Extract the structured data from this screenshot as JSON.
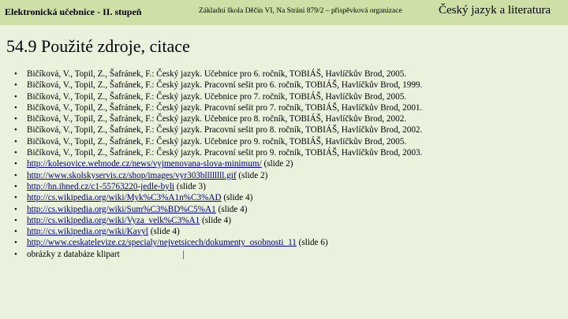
{
  "header": {
    "left": "Elektronická učebnice - II. stupeň",
    "middle": "Základní škola Děčín VI, Na Stráni 879/2 – příspěvková organizace",
    "right": "Český jazyk a literatura"
  },
  "slide": {
    "title": "54.9 Použité zdroje, citace"
  },
  "references": [
    {
      "text": "Bičíková, V., Topil, Z., Šafránek, F.: Český jazyk. Učebnice pro 6. ročník, TOBIÁŠ, Havlíčkův Brod, 2005."
    },
    {
      "text": "Bičíková, V., Topil, Z., Šafránek, F.: Český jazyk. Pracovní sešit pro 6. ročník, TOBIÁŠ, Havlíčkův Brod, 1999."
    },
    {
      "text": "Bičíková, V., Topil, Z., Šafránek, F.: Český jazyk. Učebnice pro 7. ročník, TOBIÁŠ, Havlíčkův Brod, 2005."
    },
    {
      "text": "Bičíková, V., Topil, Z., Šafránek, F.: Český jazyk. Pracovní sešit pro 7. ročník, TOBIÁŠ, Havlíčkův Brod, 2001."
    },
    {
      "text": "Bičíková, V., Topil, Z., Šafránek, F.: Český jazyk. Učebnice pro 8. ročník, TOBIÁŠ, Havlíčkův Brod, 2002."
    },
    {
      "text": "Bičíková, V., Topil, Z., Šafránek, F.: Český jazyk. Pracovní sešit pro 8. ročník, TOBIÁŠ, Havlíčkův Brod, 2002."
    },
    {
      "text": "Bičíková, V., Topil, Z., Šafránek, F.: Český jazyk. Učebnice pro 9. ročník, TOBIÁŠ, Havlíčkův Brod, 2005."
    },
    {
      "text": "Bičíková, V., Topil, Z., Šafránek, F.: Český jazyk. Pracovní sešit pro 9. ročník, TOBIÁŠ, Havlíčkův Brod, 2003."
    },
    {
      "link": "http://kolesovice.webnode.cz/news/vyjmenovana-slova-minimum/",
      "suffix": " (slide 2)"
    },
    {
      "link": "http://www.skolskyservis.cz/shop/images/vyr303bllllllll.gif",
      "suffix": " (slide 2)"
    },
    {
      "link": "http://hn.ihned.cz/c1-55763220-jedle-byli",
      "suffix": " (slide 3)"
    },
    {
      "link": "http://cs.wikipedia.org/wiki/Myk%C3%A1n%C3%AD",
      "suffix": " (slide 4)"
    },
    {
      "link": "http://cs.wikipedia.org/wiki/Sum%C3%BD%C5%A1",
      "suffix": " (slide 4)"
    },
    {
      "link": "http://cs.wikipedia.org/wiki/Vyza_velk%C3%A1",
      "suffix": " (slide 4)"
    },
    {
      "link": "http://cs.wikipedia.org/wiki/Kavyl",
      "suffix": " (slide 4)"
    },
    {
      "link": "http://www.ceskatelevize.cz/specialy/nejvetsicech/dokumenty_osobnosti_11",
      "suffix": " (slide 6)"
    },
    {
      "text": "obrázky z databáze klipart"
    }
  ],
  "bullet_char": "•"
}
